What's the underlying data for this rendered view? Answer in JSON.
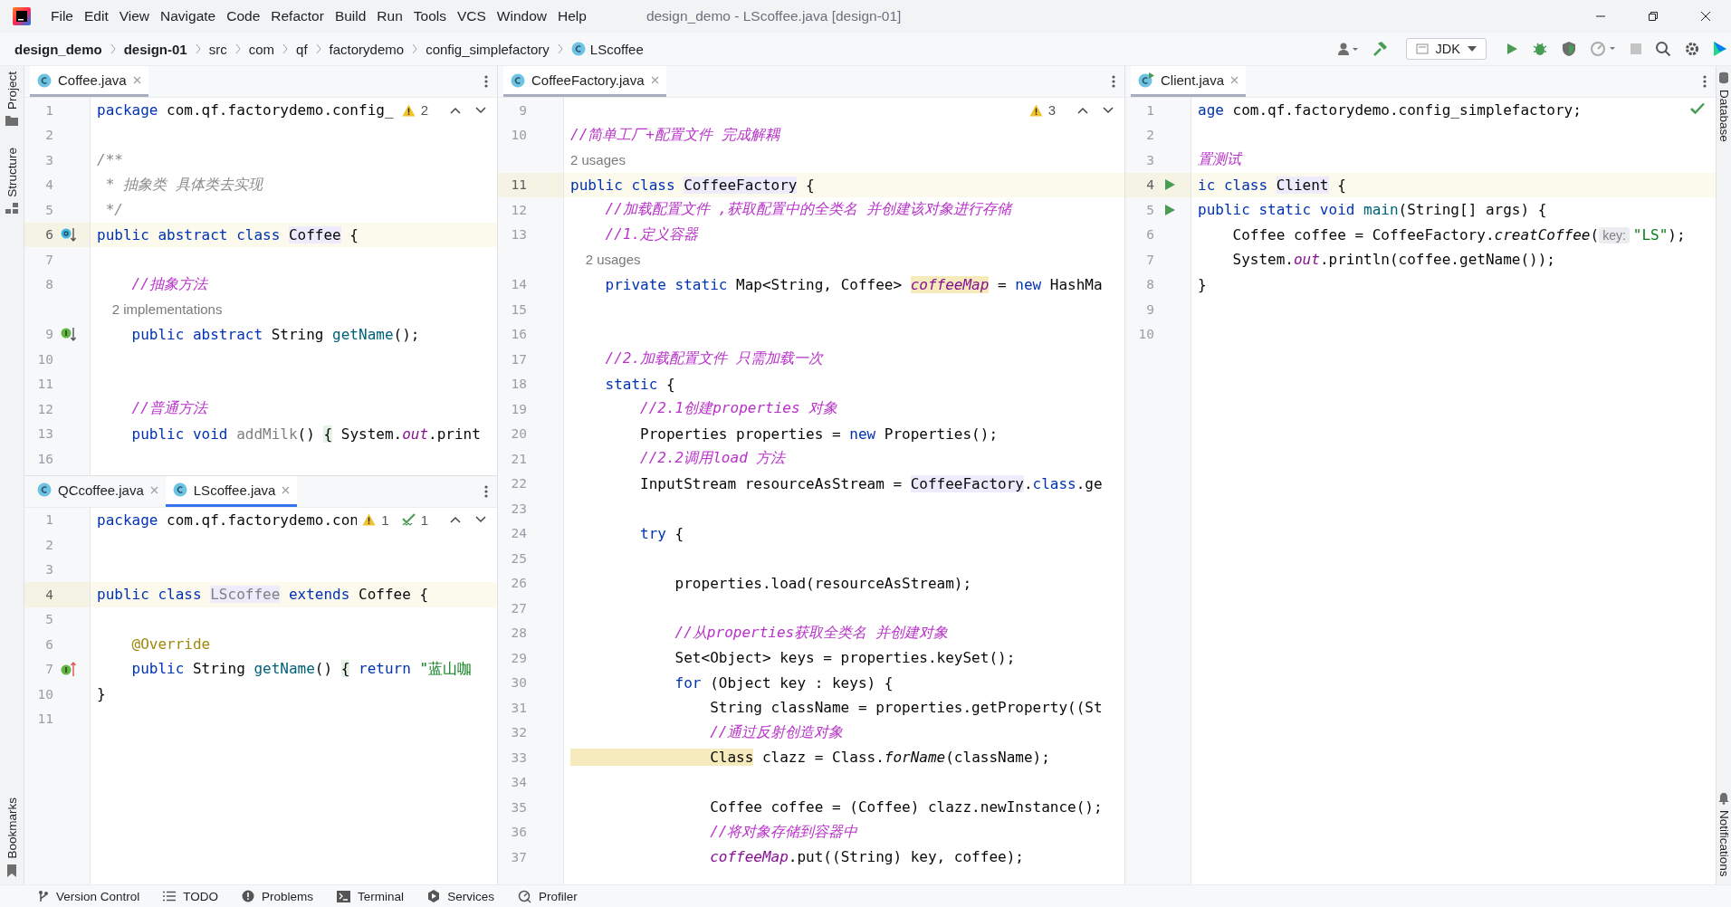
{
  "menu": [
    "File",
    "Edit",
    "View",
    "Navigate",
    "Code",
    "Refactor",
    "Build",
    "Run",
    "Tools",
    "VCS",
    "Window",
    "Help"
  ],
  "window": {
    "title": "design_demo - LScoffee.java [design-01]"
  },
  "breadcrumbs": [
    {
      "label": "design_demo",
      "kind": "module"
    },
    {
      "label": "design-01",
      "kind": "module"
    },
    {
      "label": "src",
      "kind": "folder"
    },
    {
      "label": "com",
      "kind": "folder"
    },
    {
      "label": "qf",
      "kind": "folder"
    },
    {
      "label": "factorydemo",
      "kind": "folder"
    },
    {
      "label": "config_simplefactory",
      "kind": "folder"
    },
    {
      "label": "LScoffee",
      "kind": "class"
    }
  ],
  "toolbar": {
    "run_config": "JDK"
  },
  "left_tools": [
    {
      "label": "Project",
      "kind": "project"
    },
    {
      "label": "Structure",
      "kind": "structure"
    }
  ],
  "left_tools_bottom": [
    {
      "label": "Bookmarks",
      "kind": "bookmarks"
    }
  ],
  "right_tools": [
    {
      "label": "Database",
      "kind": "database"
    }
  ],
  "right_tools_bottom": [
    {
      "label": "Notifications",
      "kind": "notifications"
    }
  ],
  "columns": [
    [
      {
        "focused": false,
        "tabs": [
          {
            "label": "Coffee.java",
            "kind": "class",
            "selected": true
          }
        ],
        "inspections": [
          {
            "kind": "warning",
            "count": "2"
          },
          {
            "kind": "nav"
          }
        ],
        "rows": [
          {
            "num": "1",
            "current": false,
            "segs": [
              {
                "kind": "keyword",
                "text": "package"
              },
              {
                "kind": "plain",
                "text": " com.qf.factorydemo.config_"
              }
            ]
          },
          {
            "num": "2",
            "current": false,
            "segs": []
          },
          {
            "num": "3",
            "current": false,
            "segs": [
              {
                "kind": "doc",
                "text": "/**"
              }
            ]
          },
          {
            "num": "4",
            "current": false,
            "segs": [
              {
                "kind": "doc",
                "text": " * 抽象类 具体类去实现"
              }
            ]
          },
          {
            "num": "5",
            "current": false,
            "segs": [
              {
                "kind": "doc",
                "text": " */"
              }
            ]
          },
          {
            "num": "6",
            "current": true,
            "gutter": {
              "kind": "implemented"
            },
            "segs": [
              {
                "kind": "keyword",
                "text": "public abstract class "
              },
              {
                "kind": "plain",
                "text": "Coffee",
                "highlight": {
                  "kind": "usage"
                }
              },
              {
                "kind": "plain",
                "text": " {"
              }
            ]
          },
          {
            "num": "7",
            "current": false,
            "segs": []
          },
          {
            "num": "8",
            "current": false,
            "segs": [
              {
                "kind": "comment",
                "text": "    //抽象方法"
              }
            ]
          },
          {
            "current": false,
            "segs": [
              {
                "kind": "hint",
                "text": "    2 implementations"
              }
            ]
          },
          {
            "num": "9",
            "current": false,
            "gutter": {
              "kind": "implements"
            },
            "segs": [
              {
                "kind": "keyword",
                "text": "    public abstract "
              },
              {
                "kind": "plain",
                "text": "String "
              },
              {
                "kind": "method",
                "text": "getName"
              },
              {
                "kind": "plain",
                "text": "();"
              }
            ]
          },
          {
            "num": "10",
            "current": false,
            "segs": []
          },
          {
            "num": "11",
            "current": false,
            "segs": []
          },
          {
            "num": "12",
            "current": false,
            "segs": [
              {
                "kind": "comment",
                "text": "    //普通方法"
              }
            ]
          },
          {
            "num": "13",
            "current": false,
            "segs": [
              {
                "kind": "keyword",
                "text": "    public void "
              },
              {
                "kind": "unused",
                "text": "addMilk"
              },
              {
                "kind": "plain",
                "text": "() "
              },
              {
                "kind": "plain",
                "text": "{",
                "highlight": {
                  "kind": "fold"
                }
              },
              {
                "kind": "plain",
                "text": " System."
              },
              {
                "kind": "field",
                "text": "out"
              },
              {
                "kind": "plain",
                "text": ".print"
              }
            ]
          },
          {
            "num": "16",
            "current": false,
            "segs": []
          }
        ]
      },
      {
        "focused": true,
        "tabs": [
          {
            "label": "QCcoffee.java",
            "kind": "class",
            "selected": false
          },
          {
            "label": "LScoffee.java",
            "kind": "class",
            "selected": true
          }
        ],
        "inspections": [
          {
            "kind": "warning",
            "count": "1"
          },
          {
            "kind": "typo",
            "count": "1"
          },
          {
            "kind": "nav"
          }
        ],
        "rows": [
          {
            "num": "1",
            "current": false,
            "segs": [
              {
                "kind": "keyword",
                "text": "package"
              },
              {
                "kind": "plain",
                "text": " com.qf.factorydemo.con"
              }
            ]
          },
          {
            "num": "2",
            "current": false,
            "segs": []
          },
          {
            "num": "3",
            "current": false,
            "segs": []
          },
          {
            "num": "4",
            "current": true,
            "segs": [
              {
                "kind": "keyword",
                "text": "public class "
              },
              {
                "kind": "unused",
                "text": "LScoffee",
                "highlight": {
                  "kind": "usage"
                }
              },
              {
                "kind": "keyword",
                "text": " extends "
              },
              {
                "kind": "plain",
                "text": "Coffee {"
              }
            ]
          },
          {
            "num": "5",
            "current": false,
            "segs": []
          },
          {
            "num": "6",
            "current": false,
            "segs": [
              {
                "kind": "annotation",
                "text": "    @Override"
              }
            ]
          },
          {
            "num": "7",
            "current": false,
            "gutter": {
              "kind": "overrides"
            },
            "segs": [
              {
                "kind": "keyword",
                "text": "    public "
              },
              {
                "kind": "plain",
                "text": "String "
              },
              {
                "kind": "method",
                "text": "getName"
              },
              {
                "kind": "plain",
                "text": "() "
              },
              {
                "kind": "plain",
                "text": "{",
                "highlight": {
                  "kind": "fold"
                }
              },
              {
                "kind": "keyword",
                "text": " return "
              },
              {
                "kind": "string",
                "text": "\"蓝山咖"
              }
            ]
          },
          {
            "num": "10",
            "current": false,
            "segs": [
              {
                "kind": "plain",
                "text": "}"
              }
            ]
          },
          {
            "num": "11",
            "current": false,
            "segs": []
          }
        ]
      }
    ],
    [
      {
        "focused": false,
        "tabs": [
          {
            "label": "CoffeeFactory.java",
            "kind": "class",
            "selected": true
          }
        ],
        "inspections": [
          {
            "kind": "warning",
            "count": "3"
          },
          {
            "kind": "nav"
          }
        ],
        "rows": [
          {
            "num": "9",
            "current": false,
            "segs": []
          },
          {
            "num": "10",
            "current": false,
            "segs": [
              {
                "kind": "comment",
                "text": "//简单工厂+配置文件 完成解耦"
              }
            ]
          },
          {
            "current": false,
            "segs": [
              {
                "kind": "hint",
                "text": "2 usages"
              }
            ]
          },
          {
            "num": "11",
            "current": true,
            "segs": [
              {
                "kind": "keyword",
                "text": "public class "
              },
              {
                "kind": "plain",
                "text": "CoffeeFactory",
                "highlight": {
                  "kind": "usage"
                }
              },
              {
                "kind": "plain",
                "text": " {"
              }
            ]
          },
          {
            "num": "12",
            "current": false,
            "segs": [
              {
                "kind": "comment",
                "text": "    //加载配置文件 ,获取配置中的全类名 并创建该对象进行存储"
              }
            ]
          },
          {
            "num": "13",
            "current": false,
            "segs": [
              {
                "kind": "comment",
                "text": "    //1.定义容器"
              }
            ]
          },
          {
            "current": false,
            "segs": [
              {
                "kind": "hint",
                "text": "    2 usages"
              }
            ]
          },
          {
            "num": "14",
            "current": false,
            "segs": [
              {
                "kind": "keyword",
                "text": "    private static "
              },
              {
                "kind": "plain",
                "text": "Map<String, Coffee> "
              },
              {
                "kind": "field",
                "text": "coffeeMap",
                "highlight": {
                  "kind": "write"
                }
              },
              {
                "kind": "plain",
                "text": " = "
              },
              {
                "kind": "keyword",
                "text": "new "
              },
              {
                "kind": "plain",
                "text": "HashMa"
              }
            ]
          },
          {
            "num": "15",
            "current": false,
            "segs": []
          },
          {
            "num": "16",
            "current": false,
            "segs": []
          },
          {
            "num": "17",
            "current": false,
            "segs": [
              {
                "kind": "comment",
                "text": "    //2.加载配置文件 只需加载一次"
              }
            ]
          },
          {
            "num": "18",
            "current": false,
            "segs": [
              {
                "kind": "keyword",
                "text": "    static "
              },
              {
                "kind": "plain",
                "text": "{"
              }
            ]
          },
          {
            "num": "19",
            "current": false,
            "segs": [
              {
                "kind": "comment",
                "text": "        //2.1创建properties 对象"
              }
            ]
          },
          {
            "num": "20",
            "current": false,
            "segs": [
              {
                "kind": "plain",
                "text": "        Properties properties = "
              },
              {
                "kind": "keyword",
                "text": "new "
              },
              {
                "kind": "plain",
                "text": "Properties();"
              }
            ]
          },
          {
            "num": "21",
            "current": false,
            "segs": [
              {
                "kind": "comment",
                "text": "        //2.2调用load 方法"
              }
            ]
          },
          {
            "num": "22",
            "current": false,
            "segs": [
              {
                "kind": "plain",
                "text": "        InputStream resourceAsStream = "
              },
              {
                "kind": "plain",
                "text": "CoffeeFactory",
                "highlight": {
                  "kind": "usage"
                }
              },
              {
                "kind": "plain",
                "text": "."
              },
              {
                "kind": "keyword",
                "text": "class"
              },
              {
                "kind": "plain",
                "text": ".ge"
              }
            ]
          },
          {
            "num": "23",
            "current": false,
            "segs": []
          },
          {
            "num": "24",
            "current": false,
            "segs": [
              {
                "kind": "keyword",
                "text": "        try "
              },
              {
                "kind": "plain",
                "text": "{"
              }
            ]
          },
          {
            "num": "25",
            "current": false,
            "segs": []
          },
          {
            "num": "26",
            "current": false,
            "segs": [
              {
                "kind": "plain",
                "text": "            properties.load(resourceAsStream);"
              }
            ]
          },
          {
            "num": "27",
            "current": false,
            "segs": []
          },
          {
            "num": "28",
            "current": false,
            "segs": [
              {
                "kind": "comment",
                "text": "            //从properties获取全类名 并创建对象"
              }
            ]
          },
          {
            "num": "29",
            "current": false,
            "segs": [
              {
                "kind": "plain",
                "text": "            Set<Object> keys = properties.keySet();"
              }
            ]
          },
          {
            "num": "30",
            "current": false,
            "segs": [
              {
                "kind": "keyword",
                "text": "            for "
              },
              {
                "kind": "plain",
                "text": "(Object key : keys) {"
              }
            ]
          },
          {
            "num": "31",
            "current": false,
            "segs": [
              {
                "kind": "plain",
                "text": "                String className = properties.getProperty((St"
              }
            ]
          },
          {
            "num": "32",
            "current": false,
            "segs": [
              {
                "kind": "comment",
                "text": "                //通过反射创造对象"
              }
            ]
          },
          {
            "num": "33",
            "current": false,
            "segs": [
              {
                "kind": "plain",
                "text": "                Class",
                "highlight": {
                  "kind": "write"
                }
              },
              {
                "kind": "plain",
                "text": " clazz = Class."
              },
              {
                "kind": "italic",
                "text": "forName"
              },
              {
                "kind": "plain",
                "text": "(className);"
              }
            ]
          },
          {
            "num": "34",
            "current": false,
            "segs": []
          },
          {
            "num": "35",
            "current": false,
            "segs": [
              {
                "kind": "plain",
                "text": "                Coffee coffee = (Coffee) clazz.newInstance();"
              }
            ]
          },
          {
            "num": "36",
            "current": false,
            "segs": [
              {
                "kind": "comment",
                "text": "                //将对象存储到容器中"
              }
            ]
          },
          {
            "num": "37",
            "current": false,
            "segs": [
              {
                "kind": "field",
                "text": "                coffeeMap"
              },
              {
                "kind": "plain",
                "text": ".put((String) key, coffee);"
              }
            ]
          }
        ]
      }
    ],
    [
      {
        "focused": false,
        "tabs": [
          {
            "label": "Client.java",
            "kind": "runnable-class",
            "selected": true
          }
        ],
        "inspections": [
          {
            "kind": "ok"
          }
        ],
        "rows": [
          {
            "num": "1",
            "current": false,
            "segs": [
              {
                "kind": "keyword",
                "text": "age"
              },
              {
                "kind": "plain",
                "text": " com.qf.factorydemo.config_simplefactory;"
              }
            ]
          },
          {
            "num": "2",
            "current": false,
            "segs": []
          },
          {
            "num": "3",
            "current": false,
            "segs": [
              {
                "kind": "comment",
                "text": "置测试"
              }
            ]
          },
          {
            "num": "4",
            "current": true,
            "gutter": {
              "kind": "run"
            },
            "segs": [
              {
                "kind": "keyword",
                "text": "ic class "
              },
              {
                "kind": "plain",
                "text": "Client",
                "highlight": {
                  "kind": "usage"
                }
              },
              {
                "kind": "plain",
                "text": " {"
              }
            ]
          },
          {
            "num": "5",
            "current": false,
            "gutter": {
              "kind": "run"
            },
            "segs": [
              {
                "kind": "keyword",
                "text": "public static void "
              },
              {
                "kind": "method",
                "text": "main"
              },
              {
                "kind": "plain",
                "text": "(String[] args) {"
              }
            ]
          },
          {
            "num": "6",
            "current": false,
            "segs": [
              {
                "kind": "plain",
                "text": "    Coffee coffee = CoffeeFactory."
              },
              {
                "kind": "italic",
                "text": "creatCoffee"
              },
              {
                "kind": "plain",
                "text": "("
              },
              {
                "kind": "inlay",
                "text": "key:"
              },
              {
                "kind": "string",
                "text": "\"LS\""
              },
              {
                "kind": "plain",
                "text": ");"
              }
            ]
          },
          {
            "num": "7",
            "current": false,
            "segs": [
              {
                "kind": "plain",
                "text": "    System."
              },
              {
                "kind": "field",
                "text": "out"
              },
              {
                "kind": "plain",
                "text": ".println(coffee.getName());"
              }
            ]
          },
          {
            "num": "8",
            "current": false,
            "segs": [
              {
                "kind": "plain",
                "text": "}"
              }
            ]
          },
          {
            "num": "9",
            "current": false,
            "segs": []
          },
          {
            "num": "10",
            "current": false,
            "segs": []
          }
        ]
      }
    ]
  ],
  "bottom_tools": [
    {
      "label": "Version Control",
      "kind": "vcs"
    },
    {
      "label": "TODO",
      "kind": "todo"
    },
    {
      "label": "Problems",
      "kind": "problems"
    },
    {
      "label": "Terminal",
      "kind": "terminal"
    },
    {
      "label": "Services",
      "kind": "services"
    },
    {
      "label": "Profiler",
      "kind": "profiler"
    }
  ]
}
